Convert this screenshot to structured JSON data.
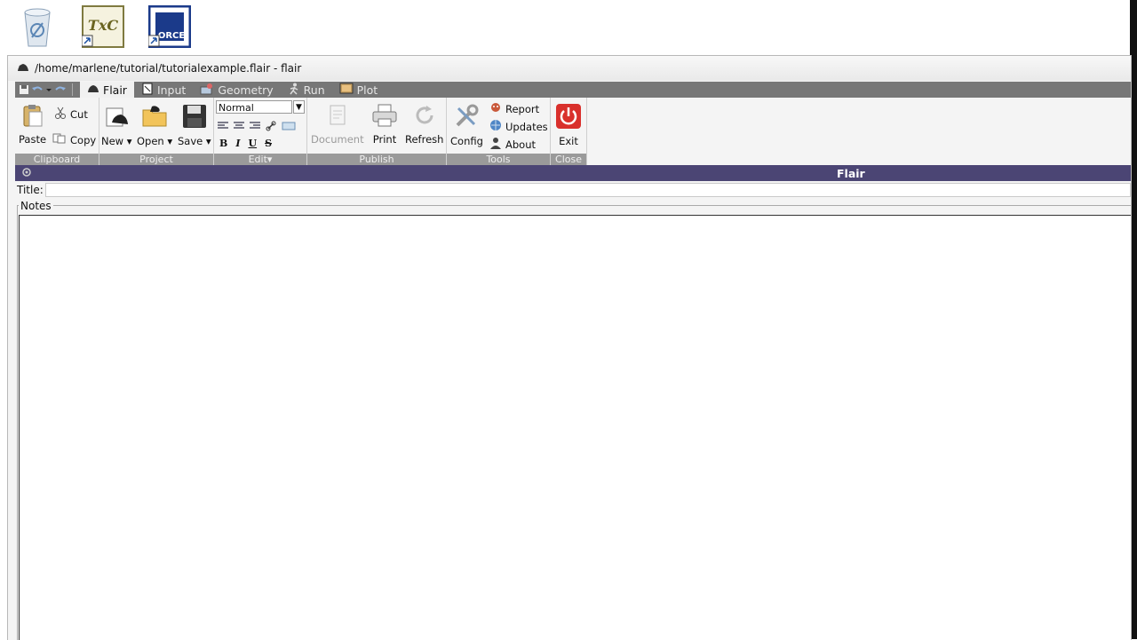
{
  "window": {
    "title": "/home/marlene/tutorial/tutorialexample.flair - flair"
  },
  "desktop": {
    "icons": [
      "recycle-bin-icon",
      "txc-icon",
      "force-icon"
    ],
    "txc_label": "TxC",
    "force_label": "ORCE"
  },
  "tabs": [
    {
      "label": "Flair",
      "icon": "flair-icon"
    },
    {
      "label": "Input",
      "icon": "input-icon"
    },
    {
      "label": "Geometry",
      "icon": "geometry-icon"
    },
    {
      "label": "Run",
      "icon": "run-icon"
    },
    {
      "label": "Plot",
      "icon": "plot-icon"
    }
  ],
  "ribbon": {
    "clipboard": {
      "label": "Clipboard",
      "paste": "Paste",
      "cut": "Cut",
      "copy": "Copy"
    },
    "project": {
      "label": "Project",
      "new": "New",
      "open": "Open",
      "save": "Save"
    },
    "edit": {
      "label": "Edit",
      "style_value": "Normal"
    },
    "publish": {
      "label": "Publish",
      "document": "Document",
      "print": "Print",
      "refresh": "Refresh"
    },
    "tools": {
      "label": "Tools",
      "config": "Config",
      "report": "Report",
      "updates": "Updates",
      "about": "About"
    },
    "close": {
      "label": "Close",
      "exit": "Exit"
    }
  },
  "panel": {
    "title": "Flair"
  },
  "form": {
    "title_label": "Title:",
    "title_value": "",
    "notes_label": "Notes",
    "notes_value": ""
  },
  "colors": {
    "panel_bar": "#4b4574",
    "tab_strip": "#777777",
    "group_label": "#9a9a9a",
    "exit_red": "#d9302c"
  }
}
